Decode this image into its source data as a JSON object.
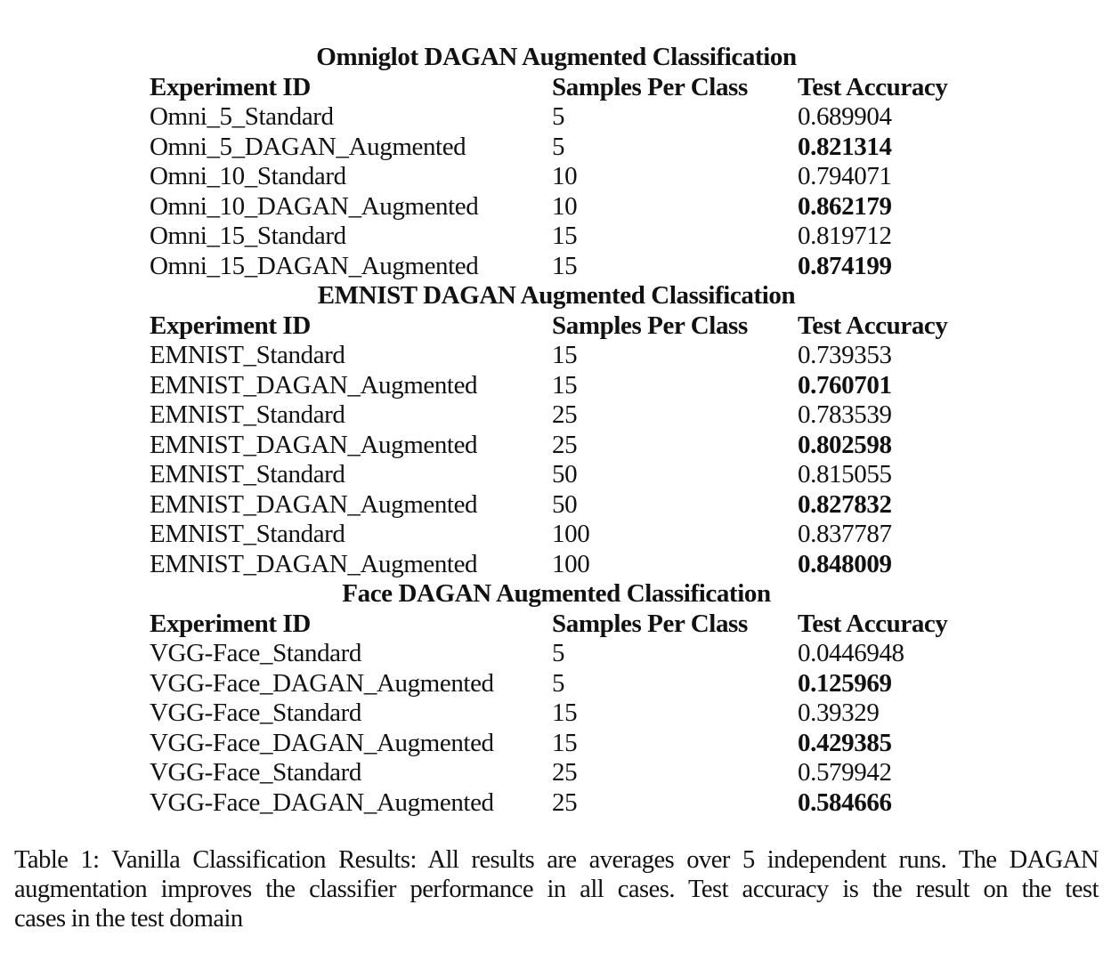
{
  "sections": [
    {
      "title": "Omniglot DAGAN Augmented Classification",
      "headers": [
        "Experiment ID",
        "Samples Per Class",
        "Test Accuracy"
      ],
      "rows": [
        {
          "id": "Omni_5_Standard",
          "samples": "5",
          "accuracy": "0.689904",
          "best": false
        },
        {
          "id": "Omni_5_DAGAN_Augmented",
          "samples": "5",
          "accuracy": "0.821314",
          "best": true
        },
        {
          "id": "Omni_10_Standard",
          "samples": "10",
          "accuracy": "0.794071",
          "best": false
        },
        {
          "id": "Omni_10_DAGAN_Augmented",
          "samples": "10",
          "accuracy": "0.862179",
          "best": true
        },
        {
          "id": "Omni_15_Standard",
          "samples": "15",
          "accuracy": "0.819712",
          "best": false
        },
        {
          "id": "Omni_15_DAGAN_Augmented",
          "samples": "15",
          "accuracy": "0.874199",
          "best": true
        }
      ]
    },
    {
      "title": "EMNIST DAGAN Augmented Classification",
      "headers": [
        "Experiment ID",
        "Samples Per Class",
        "Test Accuracy"
      ],
      "rows": [
        {
          "id": "EMNIST_Standard",
          "samples": "15",
          "accuracy": "0.739353",
          "best": false
        },
        {
          "id": "EMNIST_DAGAN_Augmented",
          "samples": "15",
          "accuracy": "0.760701",
          "best": true
        },
        {
          "id": "EMNIST_Standard",
          "samples": "25",
          "accuracy": "0.783539",
          "best": false
        },
        {
          "id": "EMNIST_DAGAN_Augmented",
          "samples": "25",
          "accuracy": "0.802598",
          "best": true
        },
        {
          "id": "EMNIST_Standard",
          "samples": "50",
          "accuracy": "0.815055",
          "best": false
        },
        {
          "id": "EMNIST_DAGAN_Augmented",
          "samples": "50",
          "accuracy": "0.827832",
          "best": true
        },
        {
          "id": "EMNIST_Standard",
          "samples": "100",
          "accuracy": "0.837787",
          "best": false
        },
        {
          "id": "EMNIST_DAGAN_Augmented",
          "samples": "100",
          "accuracy": "0.848009",
          "best": true
        }
      ]
    },
    {
      "title": "Face DAGAN Augmented Classification",
      "headers": [
        "Experiment ID",
        "Samples Per Class",
        "Test Accuracy"
      ],
      "rows": [
        {
          "id": "VGG-Face_Standard",
          "samples": "5",
          "accuracy": "0.0446948",
          "best": false
        },
        {
          "id": "VGG-Face_DAGAN_Augmented",
          "samples": "5",
          "accuracy": "0.125969",
          "best": true
        },
        {
          "id": "VGG-Face_Standard",
          "samples": "15",
          "accuracy": "0.39329",
          "best": false
        },
        {
          "id": "VGG-Face_DAGAN_Augmented",
          "samples": "15",
          "accuracy": "0.429385",
          "best": true
        },
        {
          "id": "VGG-Face_Standard",
          "samples": "25",
          "accuracy": "0.579942",
          "best": false
        },
        {
          "id": "VGG-Face_DAGAN_Augmented",
          "samples": "25",
          "accuracy": "0.584666",
          "best": true
        }
      ]
    }
  ],
  "caption": {
    "lines": [
      "Table 1: Vanilla Classification Results: All results are averages over 5 independent runs. The DAGAN",
      "augmentation improves the classifier performance in all cases. Test accuracy is the result on the test",
      "cases in the test domain"
    ]
  }
}
